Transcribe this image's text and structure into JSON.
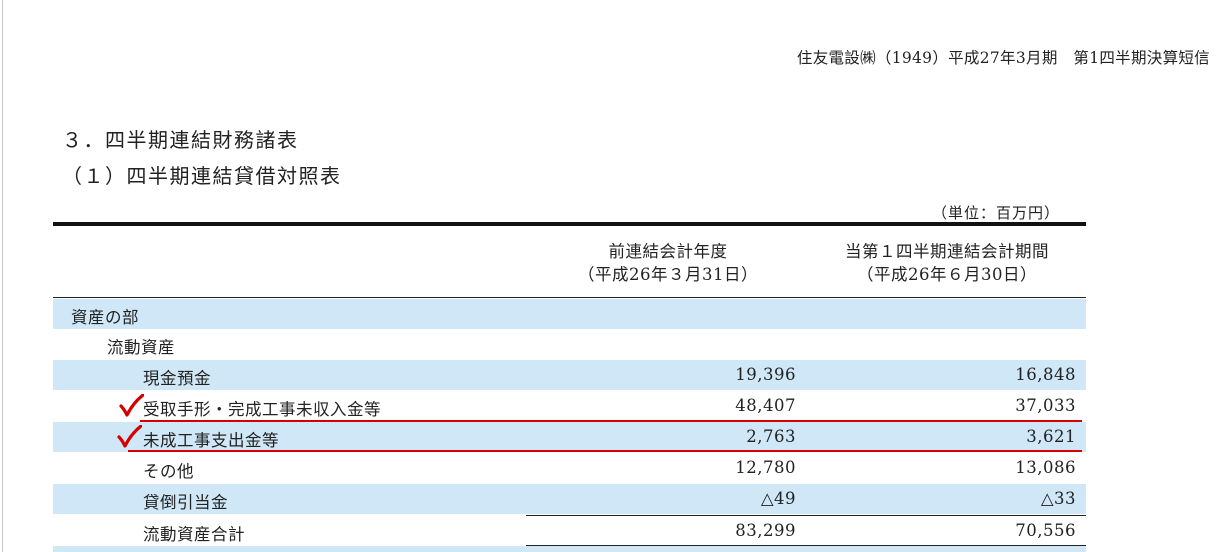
{
  "header": {
    "note": "住友電設㈱（1949）平成27年3月期　第1四半期決算短信"
  },
  "titles": {
    "section": "３．四半期連結財務諸表",
    "subsection": "（１）四半期連結貸借対照表",
    "unit": "（単位：百万円）"
  },
  "columns": {
    "prev_line1": "前連結会計年度",
    "prev_line2": "（平成26年３月31日）",
    "curr_line1": "当第１四半期連結会計期間",
    "curr_line2": "（平成26年６月30日）"
  },
  "rows": [
    {
      "label": "資産の部",
      "v1": "",
      "v2": ""
    },
    {
      "label": "流動資産",
      "v1": "",
      "v2": ""
    },
    {
      "label": "現金預金",
      "v1": "19,396",
      "v2": "16,848"
    },
    {
      "label": "受取手形・完成工事未収入金等",
      "v1": "48,407",
      "v2": "37,033"
    },
    {
      "label": "未成工事支出金等",
      "v1": "2,763",
      "v2": "3,621"
    },
    {
      "label": "その他",
      "v1": "12,780",
      "v2": "13,086"
    },
    {
      "label": "貸倒引当金",
      "v1": "△49",
      "v2": "△33"
    },
    {
      "label": "流動資産合計",
      "v1": "83,299",
      "v2": "70,556"
    }
  ],
  "annotations": {
    "mark_color": "#d40000"
  }
}
